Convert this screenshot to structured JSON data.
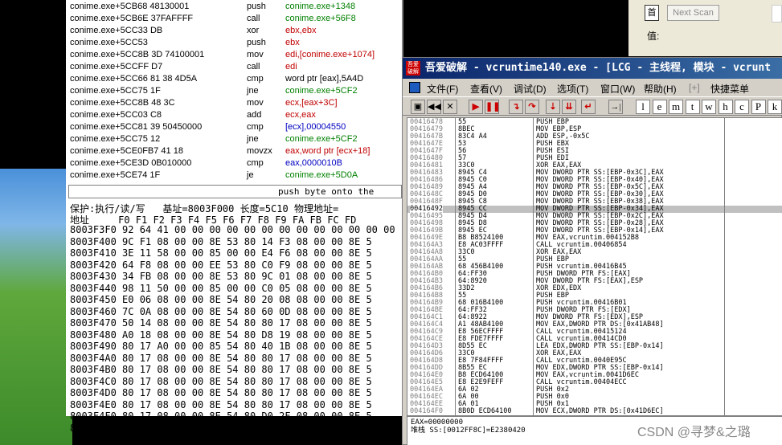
{
  "disasm": [
    {
      "addr": "conime.exe+5CB68 48130001",
      "op": "push",
      "arg": "conime.exe+1348",
      "cmt": "[FFFFFFFF]",
      "argcolor": "green"
    },
    {
      "addr": "conime.exe+5CB6E 37FAFFFF",
      "op": "call",
      "arg": "conime.exe+56F8",
      "cmt": "",
      "argcolor": "green"
    },
    {
      "addr": "conime.exe+5CC33 DB",
      "op": "xor",
      "arg": "ebx,ebx",
      "cmt": "",
      "argcolor": "red"
    },
    {
      "addr": "conime.exe+5CC53",
      "op": "push",
      "arg": "ebx",
      "cmt": "",
      "argcolor": "red"
    },
    {
      "addr": "conime.exe+5CC8B 3D 74100001",
      "op": "mov",
      "arg": "edi,[conime.exe+1074]",
      "cmt": "[7C90B731]",
      "argcolor": "red"
    },
    {
      "addr": "conime.exe+5CCFF D7",
      "op": "call",
      "arg": "edi",
      "cmt": "",
      "argcolor": "red"
    },
    {
      "addr": "conime.exe+5CC66 81 38 4D5A",
      "op": "cmp",
      "arg": "word ptr [eax],5A4D",
      "cmt": "",
      "argcolor": "mixed"
    },
    {
      "addr": "conime.exe+5CC75 1F",
      "op": "jne",
      "arg": "conime.exe+5CF2",
      "cmt": "",
      "argcolor": "green"
    },
    {
      "addr": "conime.exe+5CC8B 48 3C",
      "op": "mov",
      "arg": "ecx,[eax+3C]",
      "cmt": "",
      "argcolor": "red"
    },
    {
      "addr": "conime.exe+5CC03 C8",
      "op": "add",
      "arg": "ecx,eax",
      "cmt": "",
      "argcolor": "red"
    },
    {
      "addr": "conime.exe+5CC81 39 50450000",
      "op": "cmp",
      "arg": "[ecx],00004550",
      "cmt": "",
      "argcolor": "blue"
    },
    {
      "addr": "conime.exe+5CC75 12",
      "op": "jne",
      "arg": "conime.exe+5CF2",
      "cmt": "",
      "argcolor": "green"
    },
    {
      "addr": "conime.exe+5CE0FB7 41 18",
      "op": "movzx",
      "arg": "eax,word ptr [ecx+18]",
      "cmt": "",
      "argcolor": "red"
    },
    {
      "addr": "conime.exe+5CE3D 0B010000",
      "op": "cmp",
      "arg": "eax,0000010B",
      "cmt": "",
      "argcolor": "blue"
    },
    {
      "addr": "conime.exe+5CE74 1F",
      "op": "je",
      "arg": "conime.exe+5D0A",
      "cmt": "",
      "argcolor": "green"
    }
  ],
  "cmdbar": "push byte onto the",
  "hex": {
    "info": "保护:执行/读/写   基址=8003F000 长度=5C10 物理地址=",
    "cols": "地址     F0 F1 F2 F3 F4 F5 F6 F7 F8 F9 FA FB FC FD",
    "rows": [
      "8003F3F0 92 64 41 00 00 00 00 00 00 00 00 00 00 00 00 00",
      "8003F400 9C F1 08 00 00 8E 53 80 14 F3 08 00 00 8E 5",
      "8003F410 3E 11 58 00 00 85 00 00 E4 F6 08 00 00 8E 5",
      "8003F420 64 F8 08 00 00 EE 53 80 C0 F9 08 00 00 8E 5",
      "8003F430 34 FB 08 00 00 8E 53 80 9C 01 08 00 00 8E 5",
      "8003F440 98 11 50 00 00 85 00 00 C0 05 08 00 00 8E 5",
      "8003F450 E0 06 08 00 00 8E 54 80 20 08 08 00 00 8E 5",
      "8003F460 7C 0A 08 00 00 8E 54 80 60 0D 08 00 00 8E 5",
      "8003F470 50 14 08 00 00 8E 54 80 80 17 08 00 00 8E 5",
      "8003F480 A0 18 08 00 00 8E 54 80 D8 19 08 00 00 8E 5",
      "8003F490 80 17 A0 00 00 85 54 80 40 1B 08 00 00 8E 5",
      "8003F4A0 80 17 08 00 00 8E 54 80 80 17 08 00 00 8E 5",
      "8003F4B0 80 17 08 00 00 8E 54 80 80 17 08 00 00 8E 5",
      "8003F4C0 80 17 08 00 00 8E 54 80 80 17 08 00 00 8E 5",
      "8003F4D0 80 17 08 00 00 8E 54 80 80 17 08 00 00 8E 5",
      "8003F4E0 80 17 08 00 00 8E 54 80 80 17 08 00 00 8E 5",
      "8003F4F0 80 17 08 00 00 8E 54 80 D0 2F 08 00 00 8E 5",
      "8003F500 40 10 08 00 00 EE 40 00 00 00 08 00 00 8E 5"
    ]
  },
  "topright": {
    "next_scan": "Next Scan",
    "value_label": "值:",
    "btn": "首"
  },
  "olly": {
    "title": "吾爱破解 - vcruntime140.exe - [LCG - 主线程, 模块 - vcrunt",
    "icon": "吾爱 破解",
    "menu": [
      "文件(F)",
      "查看(V)",
      "调试(D)",
      "选项(T)",
      "窗口(W)",
      "帮助(H)",
      "[+]",
      "快捷菜单"
    ],
    "tool_letters": [
      "l",
      "e",
      "m",
      "t",
      "w",
      "h",
      "c",
      "P",
      "k"
    ],
    "rows": [
      {
        "a": "00416478",
        "h": "55",
        "s": "PUSH EBP"
      },
      {
        "a": "00416479",
        "h": "8BEC",
        "s": "MOV EBP,ESP"
      },
      {
        "a": "0041647B",
        "h": "83C4 A4",
        "s": "ADD ESP,-0x5C"
      },
      {
        "a": "0041647E",
        "h": "53",
        "s": "PUSH EBX"
      },
      {
        "a": "0041647F",
        "h": "56",
        "s": "PUSH ESI"
      },
      {
        "a": "00416480",
        "h": "57",
        "s": "PUSH EDI"
      },
      {
        "a": "00416481",
        "h": "33C0",
        "s": "XOR EAX,EAX"
      },
      {
        "a": "00416483",
        "h": "8945 C4",
        "s": "MOV DWORD PTR SS:[EBP-0x3C],EAX"
      },
      {
        "a": "00416486",
        "h": "8945 C0",
        "s": "MOV DWORD PTR SS:[EBP-0x40],EAX"
      },
      {
        "a": "00416489",
        "h": "8945 A4",
        "s": "MOV DWORD PTR SS:[EBP-0x5C],EAX"
      },
      {
        "a": "0041648C",
        "h": "8945 D0",
        "s": "MOV DWORD PTR SS:[EBP-0x30],EAX"
      },
      {
        "a": "0041648F",
        "h": "8945 C8",
        "s": "MOV DWORD PTR SS:[EBP-0x38],EAX"
      },
      {
        "a": "00416492",
        "h": "8945 CC",
        "s": "MOV DWORD PTR SS:[EBP-0x34],EAX",
        "sel": true
      },
      {
        "a": "00416495",
        "h": "8945 D4",
        "s": "MOV DWORD PTR SS:[EBP-0x2C],EAX"
      },
      {
        "a": "00416498",
        "h": "8945 D8",
        "s": "MOV DWORD PTR SS:[EBP-0x28],EAX"
      },
      {
        "a": "0041649B",
        "h": "8945 EC",
        "s": "MOV DWORD PTR SS:[EBP-0x14],EAX"
      },
      {
        "a": "0041649E",
        "h": "B8 B8524100",
        "s": "MOV EAX,vcruntim.004152B8"
      },
      {
        "a": "004164A3",
        "h": "E8 AC03FFFF",
        "s": "CALL vcruntim.00406854"
      },
      {
        "a": "004164A8",
        "h": "33C0",
        "s": "XOR EAX,EAX"
      },
      {
        "a": "004164AA",
        "h": "55",
        "s": "PUSH EBP"
      },
      {
        "a": "004164AB",
        "h": "68 456B4100",
        "s": "PUSH vcruntim.00416B45"
      },
      {
        "a": "004164B0",
        "h": "64:FF30",
        "s": "PUSH DWORD PTR FS:[EAX]"
      },
      {
        "a": "004164B3",
        "h": "64:8920",
        "s": "MOV DWORD PTR FS:[EAX],ESP"
      },
      {
        "a": "004164B6",
        "h": "33D2",
        "s": "XOR EDX,EDX"
      },
      {
        "a": "004164B8",
        "h": "55",
        "s": "PUSH EBP"
      },
      {
        "a": "004164B9",
        "h": "68 016B4100",
        "s": "PUSH vcruntim.00416B01"
      },
      {
        "a": "004164BE",
        "h": "64:FF32",
        "s": "PUSH DWORD PTR FS:[EDX]"
      },
      {
        "a": "004164C1",
        "h": "64:8922",
        "s": "MOV DWORD PTR FS:[EDX],ESP"
      },
      {
        "a": "004164C4",
        "h": "A1 48AB4100",
        "s": "MOV EAX,DWORD PTR DS:[0x41AB48]"
      },
      {
        "a": "004164C9",
        "h": "E8 56ECFFFF",
        "s": "CALL vcruntim.00415124"
      },
      {
        "a": "004164CE",
        "h": "E8 FDE7FFFF",
        "s": "CALL vcruntim.00414CD0"
      },
      {
        "a": "004164D3",
        "h": "8D55 EC",
        "s": "LEA EDX,DWORD PTR SS:[EBP-0x14]"
      },
      {
        "a": "004164D6",
        "h": "33C0",
        "s": "XOR EAX,EAX"
      },
      {
        "a": "004164D8",
        "h": "E8 7F84FFFF",
        "s": "CALL vcruntim.0040E95C"
      },
      {
        "a": "004164DD",
        "h": "8B55 EC",
        "s": "MOV EDX,DWORD PTR SS:[EBP-0x14]"
      },
      {
        "a": "004164E0",
        "h": "B8 ECD64100",
        "s": "MOV EAX,vcruntim.0041D6EC"
      },
      {
        "a": "004164E5",
        "h": "E8 E2E9FEFF",
        "s": "CALL vcruntim.00404ECC"
      },
      {
        "a": "004164EA",
        "h": "6A 02",
        "s": "PUSH 0x2"
      },
      {
        "a": "004164EC",
        "h": "6A 00",
        "s": "PUSH 0x0"
      },
      {
        "a": "004164EE",
        "h": "6A 01",
        "s": "PUSH 0x1"
      },
      {
        "a": "004164F0",
        "h": "8B0D ECD64100",
        "s": "MOV ECX,DWORD PTR DS:[0x41D6EC]"
      }
    ],
    "reg1": "EAX=00000000",
    "reg2": "堆栈 SS:[0012FF8C]=E2380420"
  },
  "watermark": "CSDN @寻梦&之璐"
}
